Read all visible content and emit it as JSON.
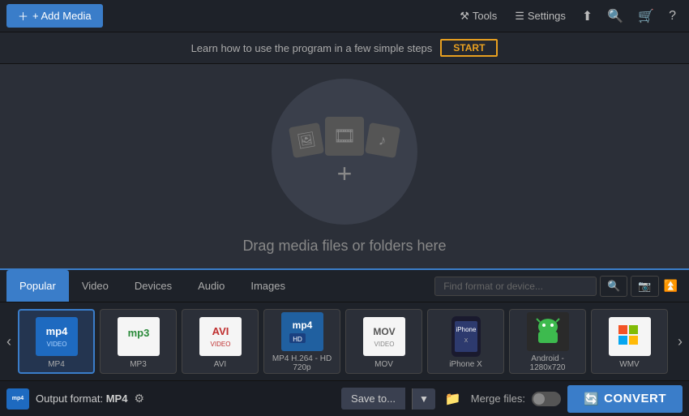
{
  "toolbar": {
    "add_media_label": "+ Add Media",
    "tools_label": "Tools",
    "settings_label": "Settings",
    "share_icon": "share",
    "search_icon": "🔍",
    "cart_icon": "🛒",
    "help_icon": "?"
  },
  "info_bar": {
    "message": "Learn how to use the program in a few simple steps",
    "start_label": "START"
  },
  "drop_area": {
    "text": "Drag media files or folders here"
  },
  "format_panel": {
    "tabs": [
      {
        "id": "popular",
        "label": "Popular",
        "active": true
      },
      {
        "id": "video",
        "label": "Video",
        "active": false
      },
      {
        "id": "devices",
        "label": "Devices",
        "active": false
      },
      {
        "id": "audio",
        "label": "Audio",
        "active": false
      },
      {
        "id": "images",
        "label": "Images",
        "active": false
      }
    ],
    "search_placeholder": "Find format or device...",
    "formats": [
      {
        "id": "mp4",
        "label": "MP4",
        "color": "#1e6ac0",
        "badge": "VIDEO",
        "selected": true
      },
      {
        "id": "mp3",
        "label": "MP3",
        "color": "#2a8a3a",
        "badge": ""
      },
      {
        "id": "avi",
        "label": "AVI",
        "color": "#c03030",
        "badge": "VIDEO"
      },
      {
        "id": "mp4hd",
        "label": "MP4 H.264 - HD 720p",
        "color": "#2060a0",
        "badge": "HD"
      },
      {
        "id": "mov",
        "label": "MOV",
        "color": "#888",
        "badge": "VIDEO"
      },
      {
        "id": "iphonex",
        "label": "iPhone X",
        "color": "#1a1a2e",
        "badge": ""
      },
      {
        "id": "android",
        "label": "Android - 1280x720",
        "color": "#3dba4e",
        "badge": ""
      },
      {
        "id": "wmv",
        "label": "WMV",
        "color": "#1565c0",
        "badge": ""
      }
    ]
  },
  "bottom_bar": {
    "output_label": "Output format:",
    "output_format": "MP4",
    "save_label": "Save to...",
    "merge_label": "Merge files:",
    "convert_label": "CONVERT"
  }
}
